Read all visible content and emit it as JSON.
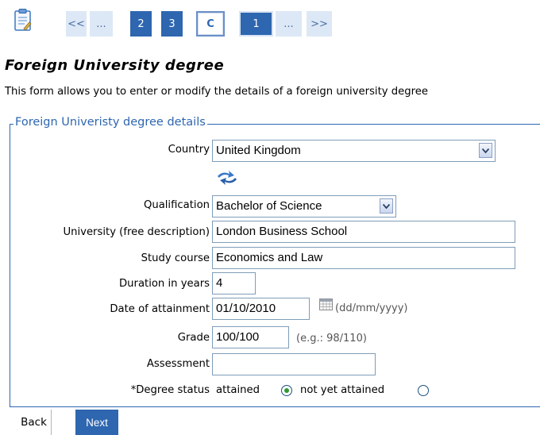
{
  "pager": {
    "first": "<<",
    "ellipsis_left": "...",
    "page_2": "2",
    "page_3": "3",
    "current": "C",
    "page_1": "1",
    "ellipsis_right": "...",
    "last": ">>"
  },
  "title": "Foreign University degree",
  "description": "This form allows you to enter or modify the details of a foreign university degree",
  "section_legend": "Foreign Univeristy degree details",
  "form": {
    "country": {
      "label": "Country",
      "value": "United Kingdom"
    },
    "qualification": {
      "label": "Qualification",
      "value": "Bachelor of Science"
    },
    "university": {
      "label": "University (free description)",
      "value": "London Business School"
    },
    "study_course": {
      "label": "Study course",
      "value": "Economics and Law"
    },
    "duration": {
      "label": "Duration in years",
      "value": "4"
    },
    "date": {
      "label": "Date of attainment",
      "value": "01/10/2010",
      "hint": "(dd/mm/yyyy)"
    },
    "grade": {
      "label": "Grade",
      "value": "100/100",
      "hint": "(e.g.: 98/110)"
    },
    "assessment": {
      "label": "Assessment",
      "value": ""
    },
    "degree_status": {
      "label": "*Degree status",
      "option_attained": "attained",
      "option_not_attained": "not yet attained",
      "selected": "attained"
    }
  },
  "buttons": {
    "back": "Back",
    "next": "Next"
  },
  "colors": {
    "accent": "#2e66b0",
    "pager_light": "#dde8f6",
    "border": "#7f9db9"
  },
  "icons": [
    "clipboard-icon",
    "refresh-arrows-icon",
    "calendar-icon",
    "chevron-down-icon"
  ]
}
